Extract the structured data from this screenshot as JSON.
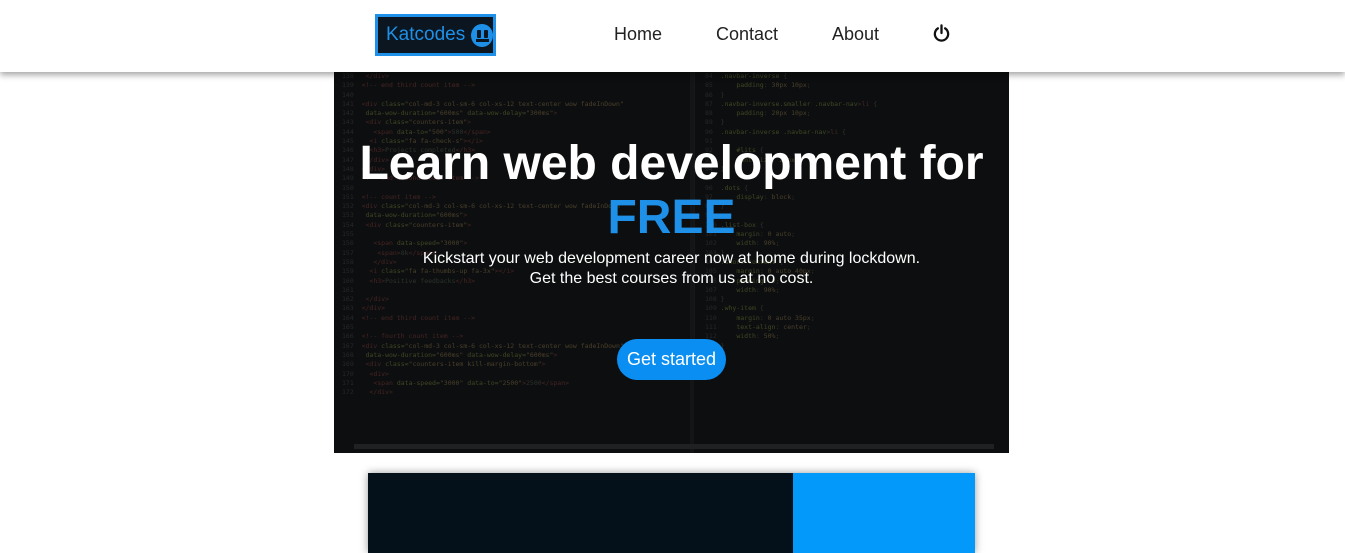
{
  "navbar": {
    "logo_text": "Katcodes",
    "logo_icon": "robot-face-icon",
    "links": [
      {
        "label": "Home"
      },
      {
        "label": "Contact"
      },
      {
        "label": "About"
      }
    ],
    "power_icon": "power-icon"
  },
  "hero": {
    "title": "Learn web development for",
    "accent": "FREE",
    "subtitle_line1": "Kickstart your web development career now at home during lockdown.",
    "subtitle_line2": "Get the best courses from us at no cost.",
    "cta_label": "Get started"
  },
  "colors": {
    "accent": "#1e90e8",
    "cta": "#0b8ef2",
    "card_dark": "#04101a",
    "card_blue": "#0399fb"
  }
}
